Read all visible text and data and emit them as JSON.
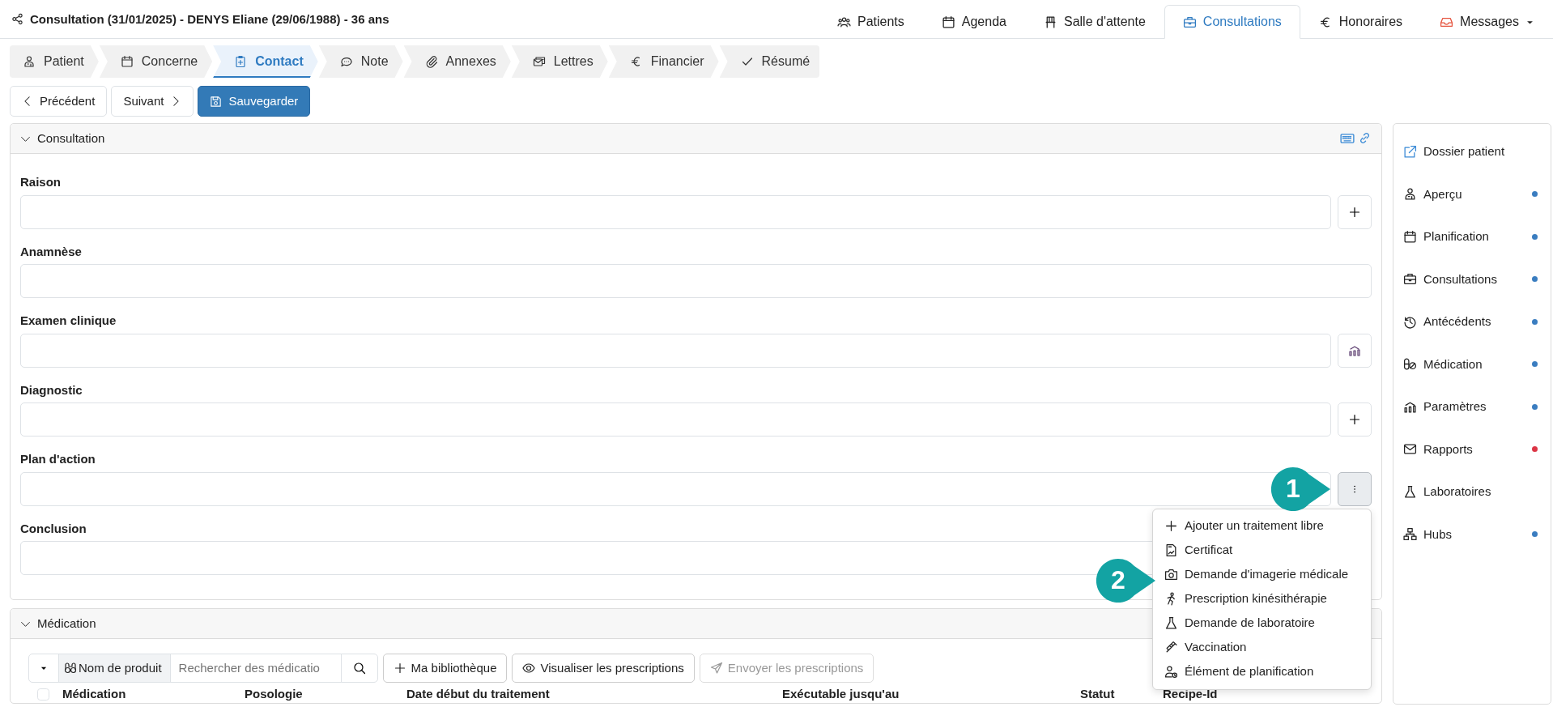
{
  "header": {
    "title": "Consultation (31/01/2025) - DENYS Eliane (29/06/1988) - 36 ans"
  },
  "main_nav": [
    {
      "label": "Patients",
      "selected": false,
      "dropdown": false
    },
    {
      "label": "Agenda",
      "selected": false,
      "dropdown": false
    },
    {
      "label": "Salle d'attente",
      "selected": false,
      "dropdown": false
    },
    {
      "label": "Consultations",
      "selected": true,
      "dropdown": false
    },
    {
      "label": "Honoraires",
      "selected": false,
      "dropdown": false
    },
    {
      "label": "Messages",
      "selected": false,
      "dropdown": true
    }
  ],
  "steps": [
    {
      "label": "Patient",
      "selected": false
    },
    {
      "label": "Concerne",
      "selected": false
    },
    {
      "label": "Contact",
      "selected": true
    },
    {
      "label": "Note",
      "selected": false
    },
    {
      "label": "Annexes",
      "selected": false
    },
    {
      "label": "Lettres",
      "selected": false
    },
    {
      "label": "Financier",
      "selected": false
    },
    {
      "label": "Résumé",
      "selected": false
    }
  ],
  "actions": [
    {
      "label": "Précédent",
      "kind": "prev"
    },
    {
      "label": "Suivant",
      "kind": "next"
    },
    {
      "label": "Sauvegarder",
      "kind": "save"
    }
  ],
  "consultation": {
    "title": "Consultation",
    "expanded": true,
    "fields": [
      {
        "label": "Raison",
        "kind": "add"
      },
      {
        "label": "Anamnèse",
        "kind": "plain"
      },
      {
        "label": "Examen clinique",
        "kind": "chart"
      },
      {
        "label": "Diagnostic",
        "kind": "add"
      },
      {
        "label": "Plan d'action",
        "kind": "menu",
        "pressed": true
      },
      {
        "label": "Conclusion",
        "kind": "plain"
      }
    ]
  },
  "action_menu": {
    "items": [
      "Ajouter un traitement libre",
      "Certificat",
      "Demande d'imagerie médicale",
      "Prescription kinésithérapie",
      "Demande de laboratoire",
      "Vaccination",
      "Élément de planification"
    ]
  },
  "callouts": [
    {
      "label": "1"
    },
    {
      "label": "2"
    }
  ],
  "medication": {
    "title": "Médication",
    "expanded": true,
    "toolbar": {
      "filter": "Nom de produit",
      "search": {
        "placeholder": "Rechercher des médicatio"
      },
      "buttons": [
        {
          "label": "Ma bibliothèque",
          "disabled": false
        },
        {
          "label": "Visualiser les prescriptions",
          "disabled": false
        },
        {
          "label": "Envoyer les prescriptions",
          "disabled": true
        }
      ]
    },
    "table": {
      "select_all": {
        "checked": false
      },
      "columns": [
        "Médication",
        "Posologie",
        "Date début du traitement",
        "Exécutable jusqu'au",
        "Statut",
        "Recipe-Id"
      ]
    }
  },
  "sidebar": {
    "items": [
      {
        "label": "Dossier patient",
        "kind": "link"
      },
      {
        "label": "Aperçu",
        "kind": "section",
        "color": "#3a7dc0"
      },
      {
        "label": "Planification",
        "kind": "section",
        "color": "#3a7dc0"
      },
      {
        "label": "Consultations",
        "kind": "section",
        "color": "#3a7dc0"
      },
      {
        "label": "Antécédents",
        "kind": "section",
        "color": "#3a7dc0"
      },
      {
        "label": "Médication",
        "kind": "section",
        "color": "#3a7dc0"
      },
      {
        "label": "Paramètres",
        "kind": "section",
        "color": "#3a7dc0"
      },
      {
        "label": "Rapports",
        "kind": "section",
        "color": "#dc3545"
      },
      {
        "label": "Laboratoires",
        "kind": "section"
      },
      {
        "label": "Hubs",
        "kind": "section",
        "color": "#3a7dc0"
      }
    ]
  }
}
